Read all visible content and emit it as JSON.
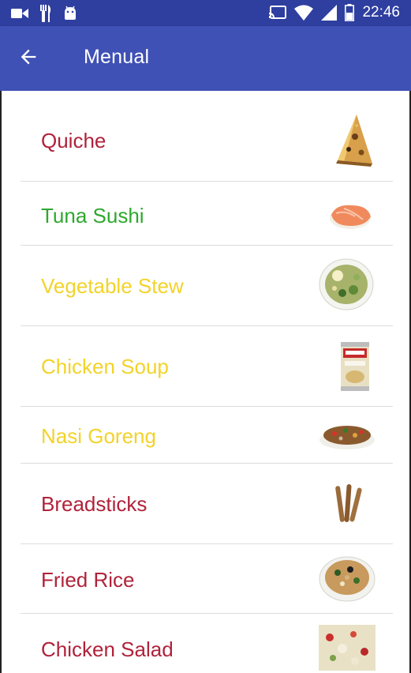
{
  "status_bar": {
    "time": "22:46",
    "left_icons": [
      "video-camera-icon",
      "fork-knife-icon",
      "android-icon"
    ],
    "right_icons": [
      "cast-icon",
      "wifi-icon",
      "cell-signal-icon",
      "battery-icon"
    ]
  },
  "app_bar": {
    "title": "Menual",
    "back_icon": "arrow-back-icon",
    "color": "#3f51b5"
  },
  "menu": {
    "items": [
      {
        "label": "Quiche",
        "color": "#b0223a",
        "image": "quiche-image"
      },
      {
        "label": "Tuna Sushi",
        "color": "#2ea82e",
        "image": "tuna-sushi-image"
      },
      {
        "label": "Vegetable Stew",
        "color": "#f2d32a",
        "image": "vegetable-stew-image"
      },
      {
        "label": "Chicken Soup",
        "color": "#f2d32a",
        "image": "chicken-soup-image"
      },
      {
        "label": "Nasi Goreng",
        "color": "#f2d32a",
        "image": "nasi-goreng-image"
      },
      {
        "label": "Breadsticks",
        "color": "#b0223a",
        "image": "breadsticks-image"
      },
      {
        "label": "Fried Rice",
        "color": "#b0223a",
        "image": "fried-rice-image"
      },
      {
        "label": "Chicken Salad",
        "color": "#b0223a",
        "image": "chicken-salad-image"
      }
    ]
  }
}
